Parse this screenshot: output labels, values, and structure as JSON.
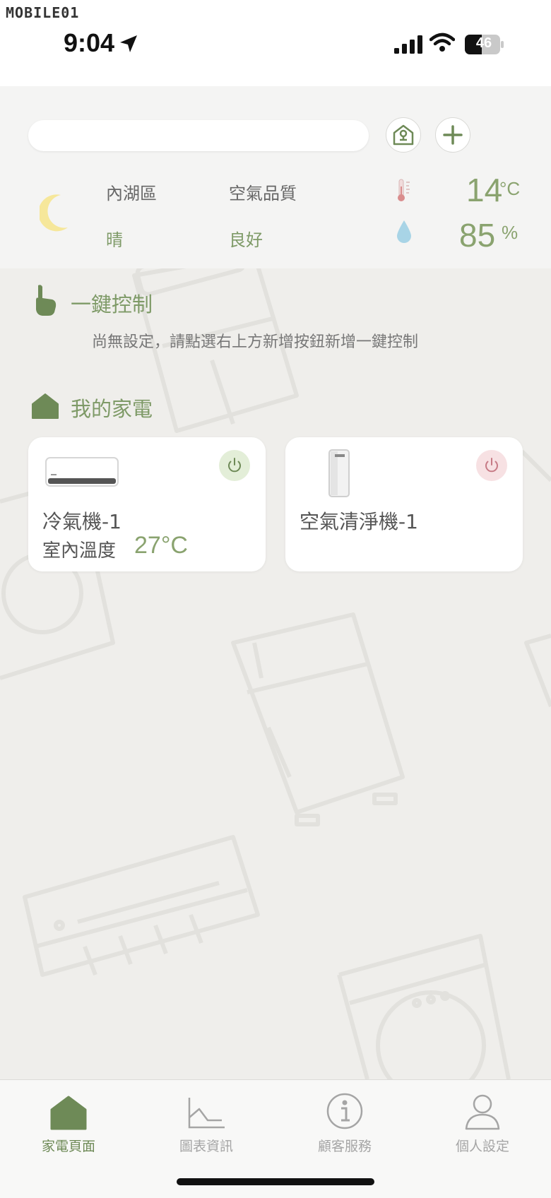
{
  "status_bar": {
    "watermark": "MOBILE01",
    "time": "9:04",
    "battery": "46"
  },
  "header": {
    "search_placeholder": "",
    "home_button_icon": "house-lock-icon",
    "add_button_icon": "plus-icon"
  },
  "weather": {
    "district": "內湖區",
    "condition": "晴",
    "air_quality_label": "空氣品質",
    "air_quality_value": "良好",
    "temperature": "14",
    "temperature_unit": "°C",
    "humidity": "85",
    "humidity_unit": "%"
  },
  "quick_control": {
    "title": "一鍵控制",
    "hint": "尚無設定，請點選右上方新增按鈕新增一鍵控制"
  },
  "my_appliances": {
    "title": "我的家電",
    "devices": [
      {
        "name": "冷氣機-1",
        "indoor_temp_label": "室內溫度",
        "indoor_temp": "27°C",
        "power_color": "#e3eed8",
        "icon": "air-conditioner-icon"
      },
      {
        "name": "空氣清淨機-1",
        "power_color": "#f7e1e3",
        "icon": "air-purifier-icon"
      }
    ]
  },
  "tab_bar": {
    "tabs": [
      {
        "label": "家電頁面",
        "icon": "home-icon",
        "active": true
      },
      {
        "label": "圖表資訊",
        "icon": "chart-icon",
        "active": false
      },
      {
        "label": "顧客服務",
        "icon": "info-icon",
        "active": false
      },
      {
        "label": "個人設定",
        "icon": "person-icon",
        "active": false
      }
    ]
  },
  "colors": {
    "accent": "#7e9a67",
    "background": "#efeeeb"
  }
}
